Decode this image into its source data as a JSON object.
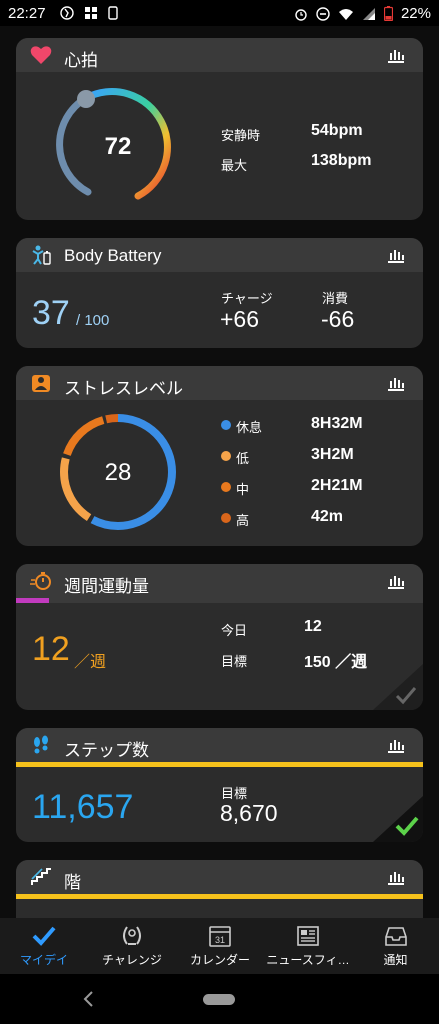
{
  "status_bar": {
    "time": "22:27",
    "battery": "22%"
  },
  "heart_rate": {
    "title": "心拍",
    "value": "72",
    "resting_label": "安静時",
    "resting_value": "54bpm",
    "max_label": "最大",
    "max_value": "138bpm"
  },
  "body_battery": {
    "title": "Body Battery",
    "value": "37",
    "of": "/ 100",
    "charge_label": "チャージ",
    "charge_value": "+66",
    "drain_label": "消費",
    "drain_value": "-66"
  },
  "stress": {
    "title": "ストレスレベル",
    "value": "28",
    "rows": [
      {
        "label": "休息",
        "value": "8H32M",
        "color": "#3a8ee6"
      },
      {
        "label": "低",
        "value": "3H2M",
        "color": "#f5a34a"
      },
      {
        "label": "中",
        "value": "2H21M",
        "color": "#e8791e"
      },
      {
        "label": "高",
        "value": "42m",
        "color": "#d9661b"
      }
    ]
  },
  "intensity": {
    "title": "週間運動量",
    "value": "12",
    "unit": "／週",
    "today_label": "今日",
    "today_value": "12",
    "goal_label": "目標",
    "goal_value": "150 ／週",
    "progress_fraction": 0.08
  },
  "steps": {
    "title": "ステップ数",
    "value": "11,657",
    "goal_label": "目標",
    "goal_value": "8,670"
  },
  "floors": {
    "title": "階"
  },
  "nav": {
    "items": [
      {
        "label": "マイデイ",
        "icon": "check-icon",
        "active": true
      },
      {
        "label": "チャレンジ",
        "icon": "laurel-icon"
      },
      {
        "label": "カレンダー",
        "icon": "calendar-icon",
        "day": "31"
      },
      {
        "label": "ニュースフィ…",
        "icon": "newsfeed-icon"
      },
      {
        "label": "通知",
        "icon": "inbox-icon"
      }
    ]
  },
  "colors": {
    "accent_blue": "#2f9bff",
    "intensity_orange": "#f0a020",
    "steps_blue": "#2aa6f0",
    "check_green": "#5cd24a",
    "yellow_bar": "#f6c21c"
  }
}
